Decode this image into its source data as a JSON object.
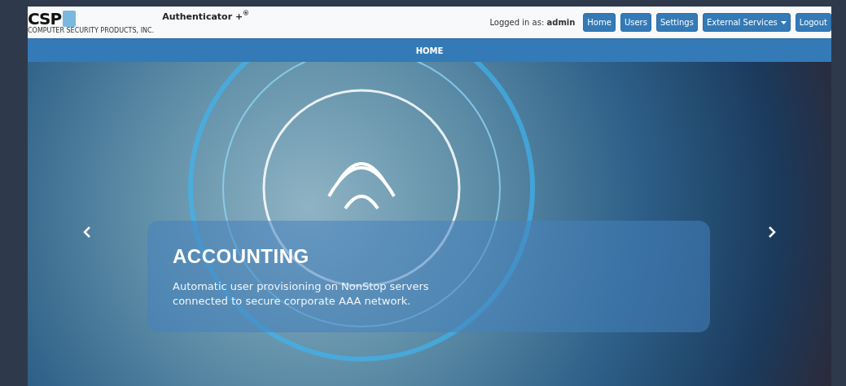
{
  "header": {
    "logo": {
      "letters": "CSP",
      "tagline": "COMPUTER SECURITY PRODUCTS, INC."
    },
    "app_title": "Authenticator +$^{®}$",
    "logged_in": "Logged in as: **admin**",
    "nav": [
      {
        "label": "Home",
        "dropdown": false
      },
      {
        "label": "Users",
        "dropdown": false
      },
      {
        "label": "Settings",
        "dropdown": false
      },
      {
        "label": "External Services",
        "dropdown": true
      },
      {
        "label": "Logout",
        "dropdown": false
      }
    ]
  },
  "section_bar": {
    "title": "HOME"
  },
  "carousel": {
    "caption_title": "ACCOUNTING",
    "caption_text": "Automatic user provisioning on NonStop servers connected to secure corporate AAA network."
  }
}
